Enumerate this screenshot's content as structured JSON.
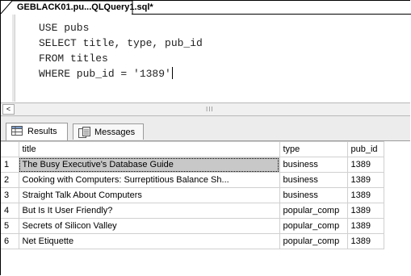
{
  "document_tab": {
    "label": "GEBLACK01.pu...QLQuery1.sql*"
  },
  "editor": {
    "lines": [
      "USE pubs",
      "SELECT title, type, pub_id",
      "FROM titles",
      "WHERE pub_id = '1389'"
    ]
  },
  "scrollbar": {
    "left_arrow": "<",
    "grip": "III"
  },
  "results_tabs": [
    {
      "label": "Results",
      "icon": "grid-icon",
      "active": true
    },
    {
      "label": "Messages",
      "icon": "messages-icon",
      "active": false
    }
  ],
  "grid": {
    "columns": [
      "title",
      "type",
      "pub_id"
    ],
    "rows": [
      {
        "num": "1",
        "title": "The Busy Executive's Database Guide",
        "type": "business",
        "pub_id": "1389"
      },
      {
        "num": "2",
        "title": "Cooking with Computers: Surreptitious Balance Sh...",
        "type": "business",
        "pub_id": "1389"
      },
      {
        "num": "3",
        "title": "Straight Talk About Computers",
        "type": "business",
        "pub_id": "1389"
      },
      {
        "num": "4",
        "title": "But Is It User Friendly?",
        "type": "popular_comp",
        "pub_id": "1389"
      },
      {
        "num": "5",
        "title": "Secrets of Silicon Valley",
        "type": "popular_comp",
        "pub_id": "1389"
      },
      {
        "num": "6",
        "title": "Net Etiquette",
        "type": "popular_comp",
        "pub_id": "1389"
      }
    ]
  }
}
